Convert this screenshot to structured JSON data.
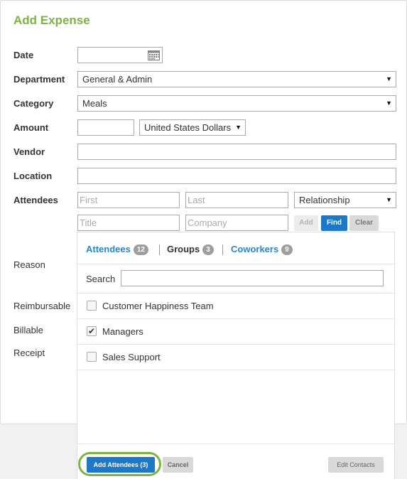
{
  "page": {
    "title": "Add Expense"
  },
  "form": {
    "date": {
      "label": "Date",
      "value": ""
    },
    "department": {
      "label": "Department",
      "value": "General & Admin"
    },
    "category": {
      "label": "Category",
      "value": "Meals"
    },
    "amount": {
      "label": "Amount",
      "value": "",
      "currency": "United States Dollars"
    },
    "vendor": {
      "label": "Vendor",
      "value": ""
    },
    "location": {
      "label": "Location",
      "value": ""
    },
    "attendees_label": "Attendees",
    "reason_label": "Reason",
    "reimbursable_label": "Reimbursable",
    "billable_label": "Billable",
    "receipt_label": "Receipt"
  },
  "attendee_inputs": {
    "first_placeholder": "First",
    "last_placeholder": "Last",
    "relationship": "Relationship",
    "title_placeholder": "Title",
    "company_placeholder": "Company",
    "add_label": "Add",
    "find_label": "Find",
    "clear_label": "Clear"
  },
  "panel": {
    "tabs": [
      {
        "label": "Attendees",
        "count": "12",
        "active": false
      },
      {
        "label": "Groups",
        "count": "3",
        "active": true
      },
      {
        "label": "Coworkers",
        "count": "9",
        "active": false
      }
    ],
    "search_label": "Search",
    "search_value": "",
    "groups": [
      {
        "label": "Customer Happiness Team",
        "checked": false
      },
      {
        "label": "Managers",
        "checked": true
      },
      {
        "label": "Sales Support",
        "checked": false
      }
    ],
    "add_attendees_label": "Add Attendees (3)",
    "cancel_label": "Cancel",
    "edit_contacts_label": "Edit Contacts"
  },
  "colors": {
    "accent_green": "#7cb342",
    "link_blue": "#2a86c9",
    "button_blue": "#1e78c8"
  }
}
